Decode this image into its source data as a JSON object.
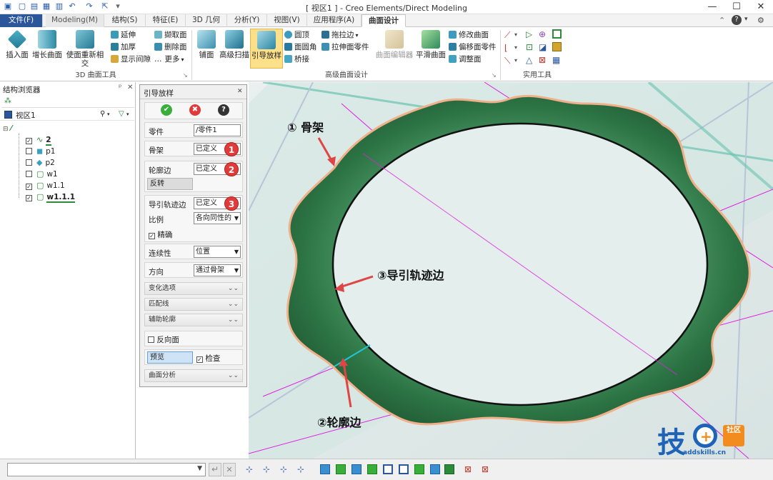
{
  "window": {
    "title": "[ 视区1 ] - Creo Elements/Direct Modeling",
    "min": "—",
    "max": "☐",
    "close": "✕",
    "help": "?"
  },
  "tabs": [
    {
      "label": "文件(F)"
    },
    {
      "label": "Modeling(M)"
    },
    {
      "label": "结构(S)"
    },
    {
      "label": "特征(E)"
    },
    {
      "label": "3D 几何"
    },
    {
      "label": "分析(Y)"
    },
    {
      "label": "视图(V)"
    },
    {
      "label": "应用程序(A)"
    },
    {
      "label": "曲面设计"
    }
  ],
  "ribbon": {
    "insert_face": "插入面",
    "grow_surface": "增长曲面",
    "make_intersect": "使面重新相交",
    "extend": "延伸",
    "thicken": "加厚",
    "show_gap": "显示间隙",
    "extract_face": "撷取面",
    "delete_face": "删除面",
    "more": "更多",
    "group1": "3D 曲面工具",
    "patch": "铺面",
    "adv_sweep": "高级扫描",
    "guided_loft": "引导放样",
    "dome": "圆顶",
    "face_fillet": "面圆角",
    "bridge": "桥接",
    "drag_edge": "拖拉边",
    "stretch_part": "拉伸面零件",
    "surface_editor": "曲面编辑器",
    "smooth_surface": "平滑曲面",
    "modify_surface": "修改曲面",
    "offset_part": "偏移面零件",
    "adjust_face": "调整面",
    "group2": "高级曲面设计",
    "group3": "实用工具"
  },
  "browser": {
    "title": "结构浏览器",
    "pin": "ᵖ",
    "close": "✕",
    "viewport_label": "视区1",
    "items": [
      {
        "label": "2",
        "checked": true,
        "bold": true,
        "underline": true
      },
      {
        "label": "p1",
        "checked": false,
        "bold": false
      },
      {
        "label": "p2",
        "checked": false,
        "bold": false
      },
      {
        "label": "w1",
        "checked": false,
        "bold": false
      },
      {
        "label": "w1.1",
        "checked": true,
        "bold": false
      },
      {
        "label": "w1.1.1",
        "checked": true,
        "bold": true,
        "underline": true
      }
    ]
  },
  "dialog": {
    "title": "引导放样",
    "close": "✕",
    "ok": "✔",
    "cancel": "✖",
    "help": "?",
    "part_label": "零件",
    "part_value": "/零件1",
    "skeleton_label": "骨架",
    "skeleton_value": "已定义",
    "badge1": "1",
    "profile_label": "轮廓边",
    "profile_value": "已定义",
    "badge2": "2",
    "reverse": "反转",
    "guide_label": "导引轨迹边",
    "guide_value": "已定义",
    "badge3": "3",
    "scale_label": "比例",
    "scale_value": "各向同性的",
    "precise_label": "精确",
    "continuity_label": "连续性",
    "continuity_value": "位置",
    "direction_label": "方向",
    "direction_value": "通过骨架",
    "section_variation": "变化选项",
    "section_match": "匹配线",
    "section_aux": "辅助轮廓",
    "reverse_face": "反向面",
    "preview": "预览",
    "check": "检查",
    "section_analysis": "曲面分析"
  },
  "callouts": {
    "c1": "① 骨架",
    "c2": "②轮廓边",
    "c3": "③导引轨迹边"
  },
  "watermark": {
    "text": "技",
    "badge": "社区",
    "url": "addskills.cn"
  },
  "colors": {
    "accent": "#2b579a",
    "surface": "#2f7a46",
    "edge": "#f0b08a",
    "construction": "#e020e0",
    "arrow": "#e04545"
  }
}
